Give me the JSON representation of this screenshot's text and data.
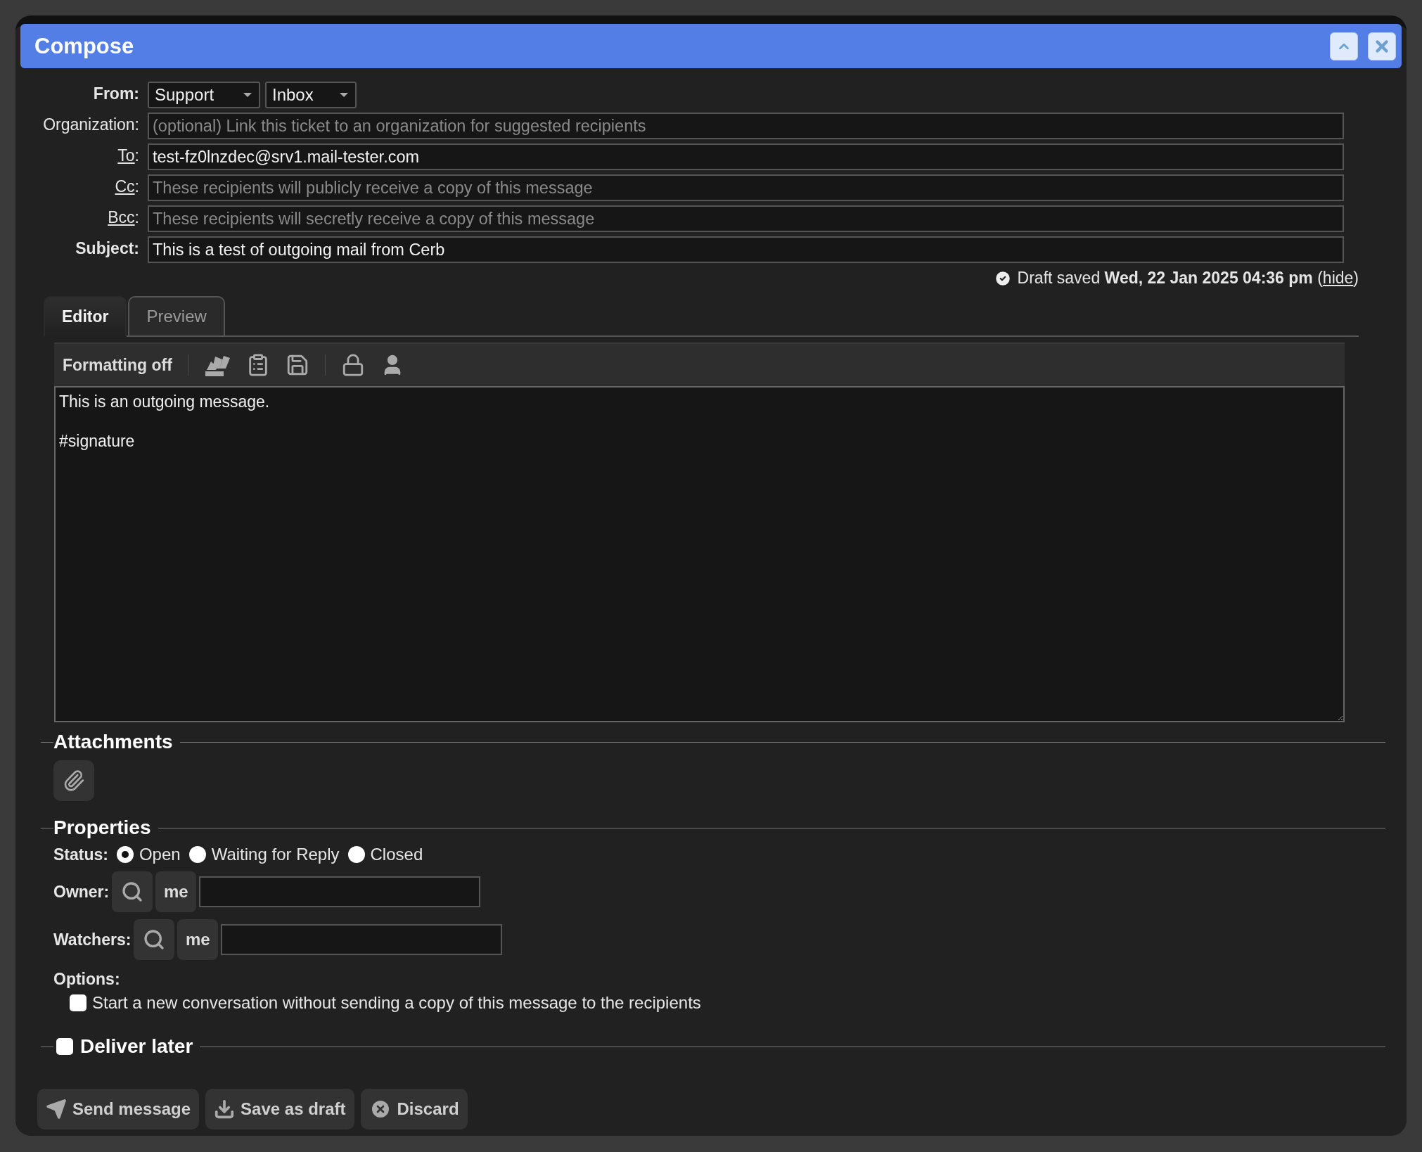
{
  "dialog": {
    "title": "Compose"
  },
  "from": {
    "label": "From:",
    "selects": [
      {
        "value": "Support"
      },
      {
        "value": "Inbox"
      }
    ]
  },
  "fields": [
    {
      "kind": "plain",
      "label": "Organization:",
      "placeholder": "(optional) Link this ticket to an organization for suggested recipients"
    },
    {
      "kind": "link",
      "label": "To",
      "suffix": ":",
      "value": "test-fz0lnzdec@srv1.mail-tester.com"
    },
    {
      "kind": "link",
      "label": "Cc",
      "suffix": ":",
      "placeholder": "These recipients will publicly receive a copy of this message"
    },
    {
      "kind": "link",
      "label": "Bcc",
      "suffix": ":",
      "placeholder": "These recipients will secretly receive a copy of this message"
    },
    {
      "kind": "bold",
      "label": "Subject:",
      "value": "This is a test of outgoing mail from Cerb"
    }
  ],
  "draft": {
    "text": "Draft saved **Wed, 22 Jan 2025 04:36 pm** (",
    "link": "hide",
    "after": ")"
  },
  "tabs": [
    {
      "label": "Editor",
      "selected": true
    },
    {
      "label": "Preview",
      "selected": false
    }
  ],
  "toolbar": {
    "formatting": "Formatting off"
  },
  "body": "This is an outgoing message.\n\n#signature",
  "attachments": {
    "heading": "Attachments"
  },
  "properties": {
    "heading": "Properties",
    "status": {
      "label": "Status:",
      "options": [
        {
          "label": "Open",
          "selected": true
        },
        {
          "label": "Waiting for Reply",
          "selected": false
        },
        {
          "label": "Closed",
          "selected": false
        }
      ]
    },
    "pickers": [
      {
        "label": "Owner:",
        "me": "me"
      },
      {
        "label": "Watchers:",
        "me": "me"
      }
    ],
    "options": {
      "label": "Options:",
      "items": [
        {
          "label": "Start a new conversation without sending a copy of this message to the recipients",
          "checked": false
        }
      ]
    }
  },
  "deliver_later": {
    "label": "Deliver later",
    "checked": false
  },
  "buttons": [
    {
      "kind": "send",
      "label": "Send message"
    },
    {
      "kind": "draft",
      "label": "Save as draft"
    },
    {
      "kind": "discard",
      "label": "Discard"
    }
  ]
}
